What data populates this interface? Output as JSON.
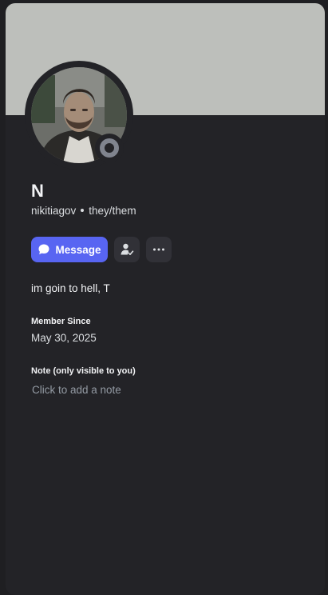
{
  "profile": {
    "display_name": "N",
    "username": "nikitiagov",
    "pronouns": "they/them",
    "bio": "im goin to hell, T",
    "member_since_label": "Member Since",
    "member_since": "May 30, 2025",
    "note_label": "Note (only visible to you)",
    "note_placeholder": "Click to add a note",
    "status": "offline"
  },
  "actions": {
    "message_label": "Message",
    "message_icon": "chat-bubble-icon",
    "friend_icon": "add-friend-icon",
    "more_icon": "more-dots-icon"
  },
  "colors": {
    "banner": "#bdbfbb",
    "card": "#232327",
    "accent": "#5865f2",
    "status_offline": "#80848e"
  }
}
